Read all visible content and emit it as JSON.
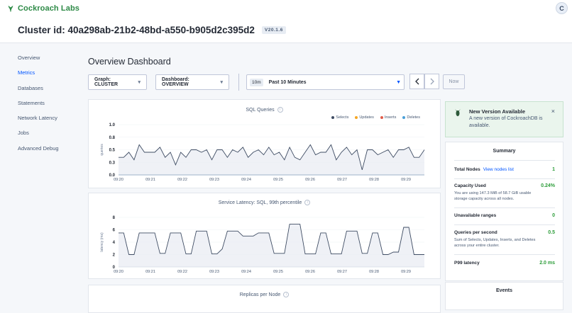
{
  "brand": {
    "name": "Cockroach Labs",
    "color": "#2d8a46"
  },
  "user": {
    "initial": "C"
  },
  "cluster": {
    "title": "Cluster id: 40a298ab-21b2-48bd-a550-b905d2c395d2",
    "version": "V20.1.6"
  },
  "sidebar": {
    "items": [
      {
        "label": "Overview",
        "active": false
      },
      {
        "label": "Metrics",
        "active": true
      },
      {
        "label": "Databases",
        "active": false
      },
      {
        "label": "Statements",
        "active": false
      },
      {
        "label": "Network Latency",
        "active": false
      },
      {
        "label": "Jobs",
        "active": false
      },
      {
        "label": "Advanced Debug",
        "active": false
      }
    ]
  },
  "main": {
    "title": "Overview Dashboard"
  },
  "controls": {
    "graph": "Graph: CLUSTER",
    "dashboard": "Dashboard: OVERVIEW",
    "time_badge": "10m",
    "time_label": "Past 10 Minutes",
    "prev_icon": "chevron-left-icon",
    "next_icon": "chevron-right-icon",
    "now_label": "Now"
  },
  "alert": {
    "title": "New Version Available",
    "text": "A new version of CockroachDB is available.",
    "close": "×"
  },
  "summary": {
    "title": "Summary",
    "total_nodes_label": "Total Nodes",
    "view_nodes_link": "View nodes list",
    "total_nodes_value": "1",
    "capacity_label": "Capacity Used",
    "capacity_value": "0.24%",
    "capacity_desc": "You are using 147.3 MiB of 58.7 GiB usable storage capacity across all nodes.",
    "unavailable_label": "Unavailable ranges",
    "unavailable_value": "0",
    "qps_label": "Queries per second",
    "qps_value": "0.5",
    "qps_desc": "Sum of Selects, Updates, Inserts, and Deletes across your entire cluster.",
    "p99_label": "P99 latency",
    "p99_value": "2.0 ms"
  },
  "events": {
    "title": "Events"
  },
  "chart_data": [
    {
      "type": "line",
      "title": "SQL Queries",
      "ylabel": "queries",
      "ylim": [
        0,
        1.0
      ],
      "yticks": [
        "0.0",
        "0.3",
        "0.5",
        "0.8",
        "1.0"
      ],
      "x_ticks": [
        "09:20",
        "09:21",
        "09:22",
        "09:23",
        "09:24",
        "09:25",
        "09:26",
        "09:27",
        "09:28",
        "09:29"
      ],
      "legend_placement": "top-right",
      "series": [
        {
          "name": "Selects",
          "color": "#3e4c63",
          "values": [
            0.35,
            0.35,
            0.45,
            0.3,
            0.6,
            0.45,
            0.45,
            0.45,
            0.55,
            0.35,
            0.45,
            0.2,
            0.45,
            0.35,
            0.5,
            0.5,
            0.45,
            0.5,
            0.3,
            0.5,
            0.5,
            0.35,
            0.5,
            0.45,
            0.55,
            0.35,
            0.45,
            0.5,
            0.4,
            0.55,
            0.4,
            0.45,
            0.3,
            0.55,
            0.35,
            0.3,
            0.45,
            0.6,
            0.4,
            0.45,
            0.45,
            0.6,
            0.3,
            0.45,
            0.55,
            0.4,
            0.5,
            0.1,
            0.5,
            0.5,
            0.4,
            0.45,
            0.5,
            0.35,
            0.5,
            0.5,
            0.55,
            0.35,
            0.35,
            0.5
          ]
        },
        {
          "name": "Updates",
          "color": "#f5a623",
          "values": [
            0,
            0,
            0,
            0,
            0,
            0,
            0,
            0,
            0,
            0,
            0,
            0,
            0,
            0,
            0,
            0,
            0,
            0,
            0,
            0,
            0,
            0,
            0,
            0,
            0,
            0,
            0,
            0,
            0,
            0,
            0,
            0,
            0,
            0,
            0,
            0,
            0,
            0,
            0,
            0,
            0,
            0,
            0,
            0,
            0,
            0,
            0,
            0,
            0,
            0,
            0,
            0,
            0,
            0,
            0,
            0,
            0,
            0,
            0,
            0
          ]
        },
        {
          "name": "Inserts",
          "color": "#e05c4a",
          "values": [
            0,
            0,
            0,
            0,
            0,
            0,
            0,
            0,
            0,
            0,
            0,
            0,
            0,
            0,
            0,
            0,
            0,
            0,
            0,
            0,
            0,
            0,
            0,
            0,
            0,
            0,
            0,
            0,
            0,
            0,
            0,
            0,
            0,
            0,
            0,
            0,
            0,
            0,
            0,
            0,
            0,
            0,
            0,
            0,
            0,
            0,
            0,
            0,
            0,
            0,
            0,
            0,
            0,
            0,
            0,
            0,
            0,
            0,
            0,
            0
          ]
        },
        {
          "name": "Deletes",
          "color": "#4a9fd8",
          "values": [
            0,
            0,
            0,
            0,
            0,
            0,
            0,
            0,
            0,
            0,
            0,
            0,
            0,
            0,
            0,
            0,
            0,
            0,
            0,
            0,
            0,
            0,
            0,
            0,
            0,
            0,
            0,
            0,
            0,
            0,
            0,
            0,
            0,
            0,
            0,
            0,
            0,
            0,
            0,
            0,
            0,
            0,
            0,
            0,
            0,
            0,
            0,
            0,
            0,
            0,
            0,
            0,
            0,
            0,
            0,
            0,
            0,
            0,
            0,
            0
          ]
        }
      ]
    },
    {
      "type": "line",
      "title": "Service Latency: SQL, 99th percentile",
      "ylabel": "latency (ms)",
      "ylim": [
        0,
        8
      ],
      "yticks": [
        "0",
        "2",
        "4",
        "6",
        "8"
      ],
      "x_ticks": [
        "09:20",
        "09:21",
        "09:22",
        "09:23",
        "09:24",
        "09:25",
        "09:26",
        "09:27",
        "09:28",
        "09:29"
      ],
      "series": [
        {
          "color": "#3e4c63",
          "values": [
            5.5,
            5.5,
            2.0,
            2.0,
            5.5,
            5.5,
            5.5,
            5.5,
            2.2,
            2.2,
            5.5,
            5.5,
            5.5,
            2.1,
            2.1,
            5.8,
            5.8,
            5.8,
            2.1,
            2.1,
            2.9,
            5.8,
            5.8,
            5.8,
            5.0,
            5.0,
            5.0,
            5.5,
            5.5,
            5.5,
            2.2,
            2.2,
            2.2,
            6.9,
            6.9,
            6.9,
            2.1,
            2.1,
            2.1,
            5.5,
            5.5,
            2.1,
            2.1,
            2.1,
            5.8,
            5.8,
            5.8,
            2.2,
            2.2,
            5.5,
            5.5,
            2.0,
            2.0,
            2.4,
            2.4,
            6.4,
            6.4,
            2.0,
            2.0,
            2.0
          ]
        }
      ]
    },
    {
      "type": "line",
      "title": "Replicas per Node"
    }
  ]
}
